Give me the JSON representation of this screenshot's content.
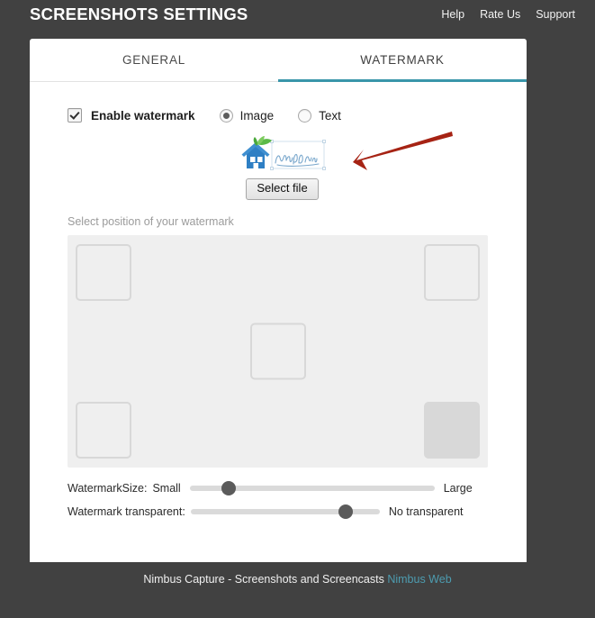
{
  "header": {
    "title": "SCREENSHOTS SETTINGS",
    "nav": [
      {
        "label": "Help",
        "name": "help"
      },
      {
        "label": "Rate Us",
        "name": "rate-us"
      },
      {
        "label": "Support",
        "name": "support"
      }
    ]
  },
  "tabs": [
    {
      "label": "GENERAL",
      "active": false
    },
    {
      "label": "WATERMARK",
      "active": true
    }
  ],
  "watermark": {
    "enable_label": "Enable watermark",
    "enable_checked": true,
    "type_options": [
      {
        "label": "Image",
        "selected": true
      },
      {
        "label": "Text",
        "selected": false
      }
    ],
    "select_file_label": "Select file",
    "preview_alt": "nimbus-web-logo",
    "position_label": "Select position of your watermark",
    "positions": [
      {
        "name": "top-left",
        "selected": false
      },
      {
        "name": "top-right",
        "selected": false
      },
      {
        "name": "center",
        "selected": false
      },
      {
        "name": "bottom-left",
        "selected": false
      },
      {
        "name": "bottom-right",
        "selected": true
      }
    ],
    "size_slider": {
      "caption": "WatermarkSize:",
      "min_label": "Small",
      "max_label": "Large",
      "value_percent": 16
    },
    "transparent_slider": {
      "caption": "Watermark transparent:",
      "min_label": "",
      "max_label": "No transparent",
      "value_percent": 82
    }
  },
  "annotation": {
    "arrow_name": "red-arrow-annotation",
    "color": "#a62314"
  },
  "footer": {
    "text": "Nimbus Capture - Screenshots and Screencasts",
    "link_label": "Nimbus Web"
  },
  "colors": {
    "header_bg": "#414141",
    "accent_teal": "#3a96aa",
    "card_bg": "#ffffff",
    "panel_bg": "#efefef"
  }
}
